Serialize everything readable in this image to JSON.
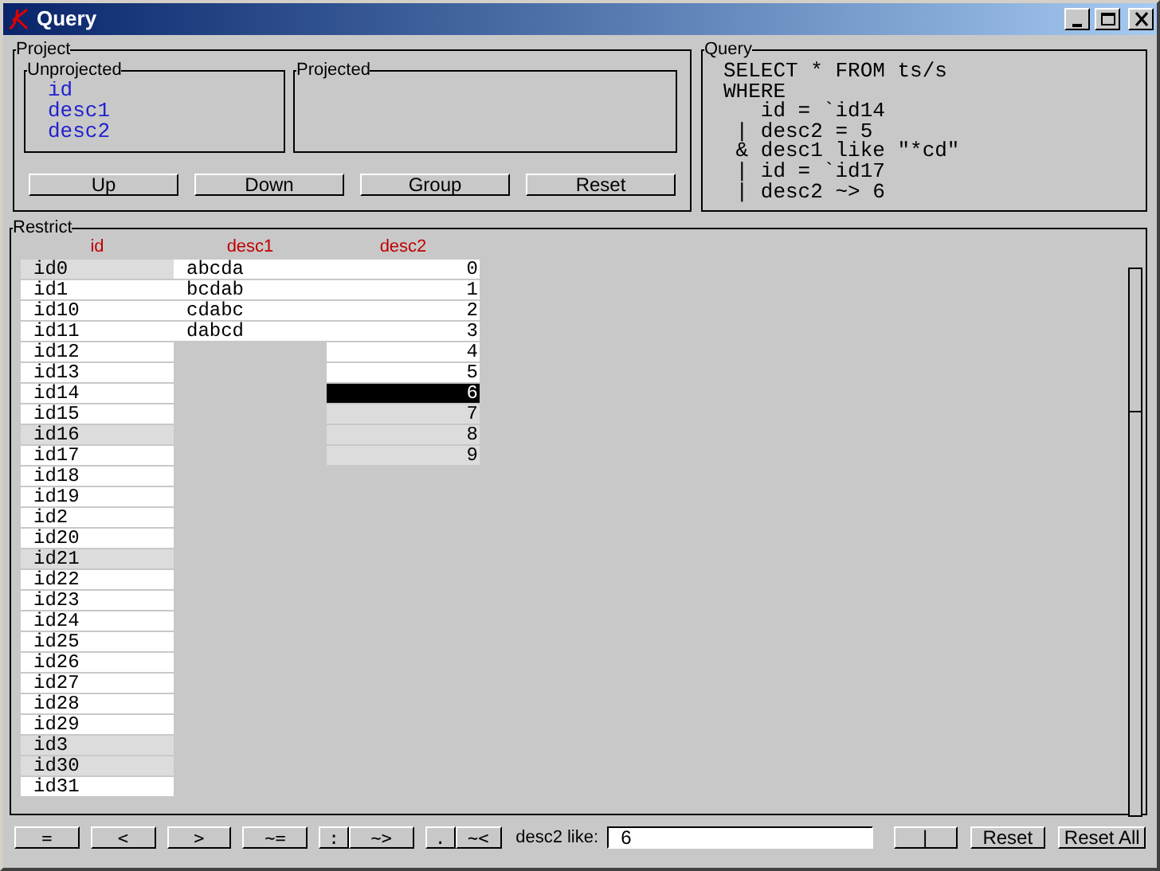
{
  "window": {
    "title": "Query"
  },
  "project": {
    "title": "Project",
    "unprojected": {
      "title": "Unprojected",
      "items": [
        "id",
        "desc1",
        "desc2"
      ]
    },
    "projected": {
      "title": "Projected"
    },
    "buttons": [
      "Up",
      "Down",
      "Group",
      "Reset"
    ]
  },
  "query": {
    "title": "Query",
    "lines": [
      "SELECT * FROM ts/s",
      "WHERE",
      "   id = `id14",
      " | desc2 = 5",
      " & desc1 like \"*cd\"",
      " | id = `id17",
      " | desc2 ~> 6"
    ]
  },
  "restrict": {
    "title": "Restrict",
    "columns": [
      {
        "name": "id",
        "kind": "text",
        "rows": [
          {
            "text": "id0",
            "highlighted": true,
            "selected": false
          },
          {
            "text": "id1",
            "highlighted": false,
            "selected": false
          },
          {
            "text": "id10",
            "highlighted": false,
            "selected": false
          },
          {
            "text": "id11",
            "highlighted": false,
            "selected": false
          },
          {
            "text": "id12",
            "highlighted": false,
            "selected": false
          },
          {
            "text": "id13",
            "highlighted": false,
            "selected": false
          },
          {
            "text": "id14",
            "highlighted": false,
            "selected": false
          },
          {
            "text": "id15",
            "highlighted": false,
            "selected": false
          },
          {
            "text": "id16",
            "highlighted": true,
            "selected": false
          },
          {
            "text": "id17",
            "highlighted": false,
            "selected": false
          },
          {
            "text": "id18",
            "highlighted": false,
            "selected": false
          },
          {
            "text": "id19",
            "highlighted": false,
            "selected": false
          },
          {
            "text": "id2",
            "highlighted": false,
            "selected": false
          },
          {
            "text": "id20",
            "highlighted": false,
            "selected": false
          },
          {
            "text": "id21",
            "highlighted": true,
            "selected": false
          },
          {
            "text": "id22",
            "highlighted": false,
            "selected": false
          },
          {
            "text": "id23",
            "highlighted": false,
            "selected": false
          },
          {
            "text": "id24",
            "highlighted": false,
            "selected": false
          },
          {
            "text": "id25",
            "highlighted": false,
            "selected": false
          },
          {
            "text": "id26",
            "highlighted": false,
            "selected": false
          },
          {
            "text": "id27",
            "highlighted": false,
            "selected": false
          },
          {
            "text": "id28",
            "highlighted": false,
            "selected": false
          },
          {
            "text": "id29",
            "highlighted": false,
            "selected": false
          },
          {
            "text": "id3",
            "highlighted": true,
            "selected": false
          },
          {
            "text": "id30",
            "highlighted": true,
            "selected": false
          },
          {
            "text": "id31",
            "highlighted": false,
            "selected": false
          }
        ]
      },
      {
        "name": "desc1",
        "kind": "text",
        "rows": [
          {
            "text": "abcda",
            "highlighted": false,
            "selected": false
          },
          {
            "text": "bcdab",
            "highlighted": false,
            "selected": false
          },
          {
            "text": "cdabc",
            "highlighted": false,
            "selected": false
          },
          {
            "text": "dabcd",
            "highlighted": false,
            "selected": false
          }
        ]
      },
      {
        "name": "desc2",
        "kind": "number",
        "rows": [
          {
            "text": "0",
            "highlighted": false,
            "selected": false
          },
          {
            "text": "1",
            "highlighted": false,
            "selected": false
          },
          {
            "text": "2",
            "highlighted": false,
            "selected": false
          },
          {
            "text": "3",
            "highlighted": false,
            "selected": false
          },
          {
            "text": "4",
            "highlighted": false,
            "selected": false
          },
          {
            "text": "5",
            "highlighted": false,
            "selected": false
          },
          {
            "text": "6",
            "highlighted": false,
            "selected": true
          },
          {
            "text": "7",
            "highlighted": true,
            "selected": false
          },
          {
            "text": "8",
            "highlighted": true,
            "selected": false
          },
          {
            "text": "9",
            "highlighted": true,
            "selected": false
          }
        ]
      }
    ]
  },
  "toolbar": {
    "operators": [
      {
        "label": "=",
        "kind": "wide"
      },
      {
        "label": "<",
        "kind": "wide"
      },
      {
        "label": ">",
        "kind": "wide"
      },
      {
        "label": "~=",
        "kind": "wide"
      },
      {
        "label": ":",
        "kind": "narrow"
      },
      {
        "label": "~>",
        "kind": "wide"
      },
      {
        "label": ".",
        "kind": "narrow"
      },
      {
        "label": "~<",
        "kind": "small"
      }
    ],
    "filter_label": "desc2 like:",
    "filter_value": "6",
    "buttons": [
      "|",
      "Reset",
      "Reset All"
    ]
  }
}
